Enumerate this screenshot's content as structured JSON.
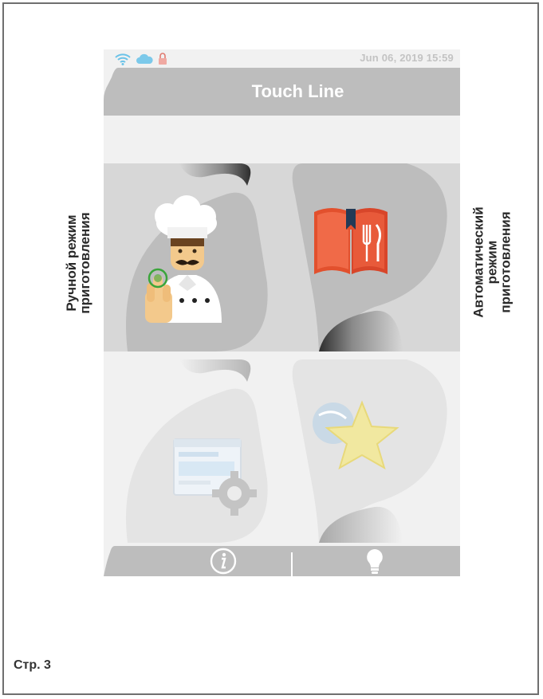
{
  "status_bar": {
    "icons": [
      "wifi-icon",
      "cloud-icon",
      "lock-icon"
    ],
    "datetime": "Jun 06, 2019  15:59"
  },
  "header": {
    "title": "Touch Line"
  },
  "tiles": [
    {
      "name": "manual-cooking",
      "icon": "chef-icon"
    },
    {
      "name": "automatic-cooking",
      "icon": "recipe-book-icon"
    },
    {
      "name": "settings",
      "icon": "settings-window-icon"
    },
    {
      "name": "favorites",
      "icon": "star-icon"
    }
  ],
  "footer": {
    "icons": [
      "info-icon",
      "lightbulb-icon"
    ]
  },
  "labels": {
    "left": {
      "line1": "Ручной режим",
      "line2": "приготовления"
    },
    "right": {
      "line1": "Автоматический",
      "line2": "режим",
      "line3": "приготовления"
    }
  },
  "page_number": "Стр. 3",
  "colors": {
    "header_bg": "#bdbdbd",
    "book_red": "#e2502d",
    "accent_green": "#3aa53a",
    "datetime": "#c3c3c3"
  }
}
